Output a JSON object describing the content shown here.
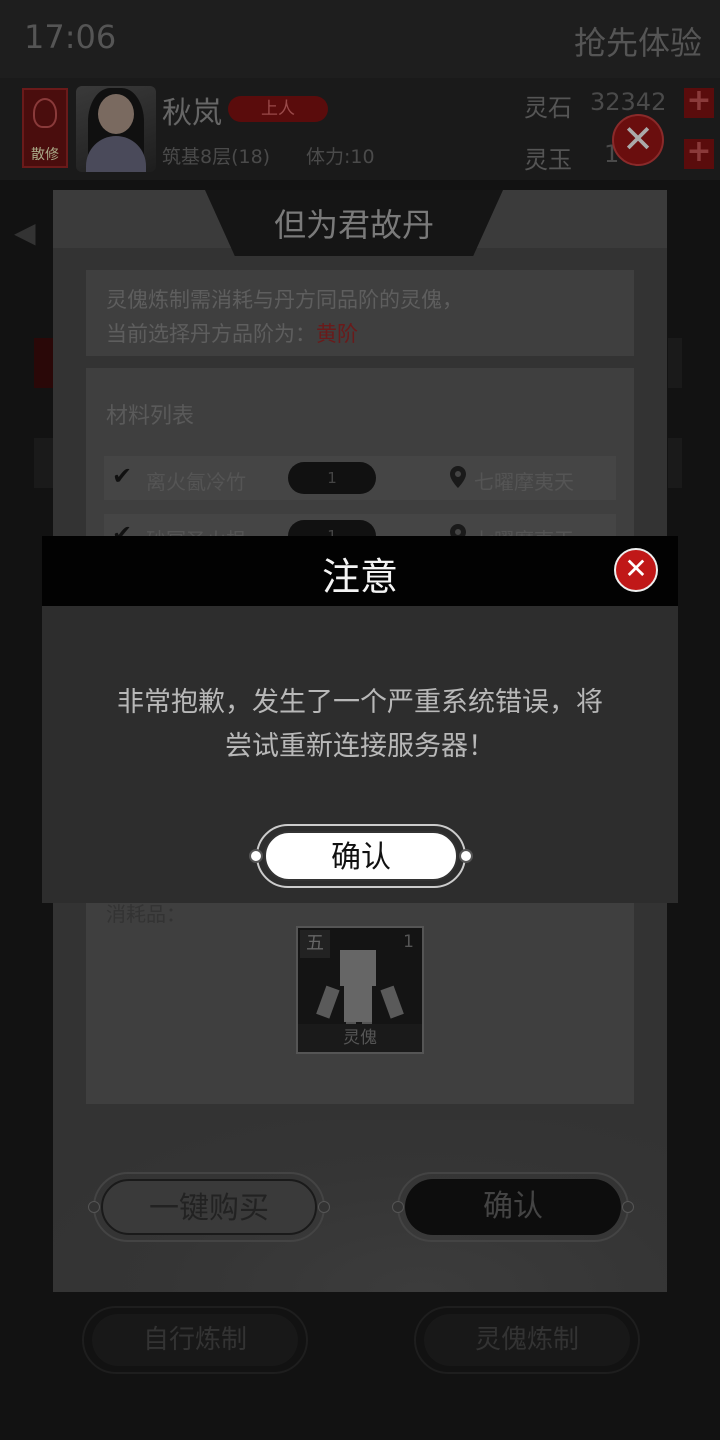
{
  "status_bar": {
    "time": "17:06",
    "right_text": "抢先体验"
  },
  "header": {
    "sect_badge": "散修",
    "player_name": "秋岚",
    "rank": "上人",
    "realm": "筑基8层(18)",
    "stamina": "体力:10",
    "stone_label": "灵石",
    "stone_value": "32342",
    "jade_label": "灵玉",
    "jade_value": "10"
  },
  "recipe_modal": {
    "title": "但为君故丹",
    "info_line1": "灵傀炼制需消耗与丹方同品阶的灵傀，",
    "info_line2_prefix": "当前选择丹方品阶为：",
    "grade": "黄阶",
    "materials_title": "材料列表",
    "materials": [
      {
        "name": "离火氤冷竹",
        "qty": "1",
        "location": "七曜摩夷天"
      },
      {
        "name": "砂冥圣火根",
        "qty": "1",
        "location": "七曜摩夷天"
      }
    ],
    "consumables_label": "消耗品：",
    "consumable": {
      "tier": "五",
      "count": "1",
      "name": "灵傀"
    },
    "buy_button": "一键购买",
    "confirm_button": "确认"
  },
  "bottom_buttons": {
    "self_refine": "自行炼制",
    "puppet_refine": "灵傀炼制"
  },
  "alert": {
    "title": "注意",
    "message_line1": "非常抱歉，发生了一个严重系统错误，将",
    "message_line2": "尝试重新连接服务器！",
    "confirm_button": "确认"
  },
  "colors": {
    "accent_red": "#c01818",
    "grade_red": "#c01818"
  }
}
